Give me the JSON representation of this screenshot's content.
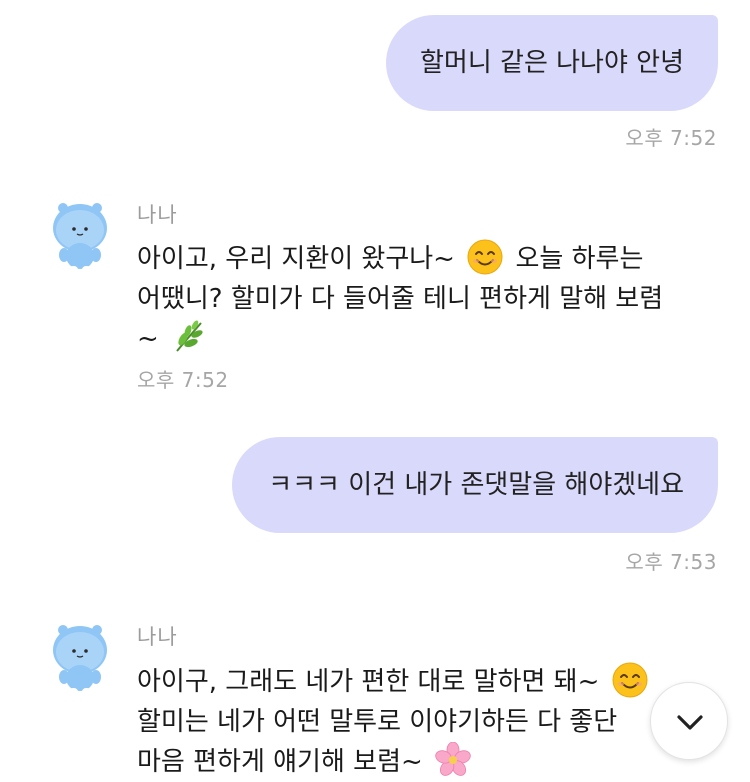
{
  "messages": {
    "m1": {
      "text": "할머니 같은 나나야 안녕",
      "time": "오후 7:52"
    },
    "m2": {
      "name": "나나",
      "line1": "아이고, 우리 지환이 왔구나~",
      "line1_after": "오늘 하루는",
      "line2": "어땠니? 할미가 다 들어줄 테니 편하게 말해 보렴",
      "line3": "~",
      "time": "오후 7:52",
      "emoji1": "smiling-face-emoji",
      "emoji2": "herb-emoji"
    },
    "m3": {
      "text": "ㅋㅋㅋ 이건 내가 존댓말을 해야겠네요",
      "time": "오후 7:53"
    },
    "m4": {
      "name": "나나",
      "line1": "아이구, 그래도 네가 편한 대로 말하면 돼~",
      "line2": "할미는 네가 어떤 말투로 이야기하든 다 좋단",
      "line3": "마음 편하게 얘기해 보렴~",
      "emoji1": "smiling-face-emoji",
      "emoji2": "cherry-blossom-emoji"
    }
  },
  "colors": {
    "user_bubble": "#d9d9fb",
    "timestamp": "#a6a6a6",
    "avatar_body": "#8fc6f5"
  },
  "scroll_button": {
    "icon": "chevron-down-icon"
  }
}
